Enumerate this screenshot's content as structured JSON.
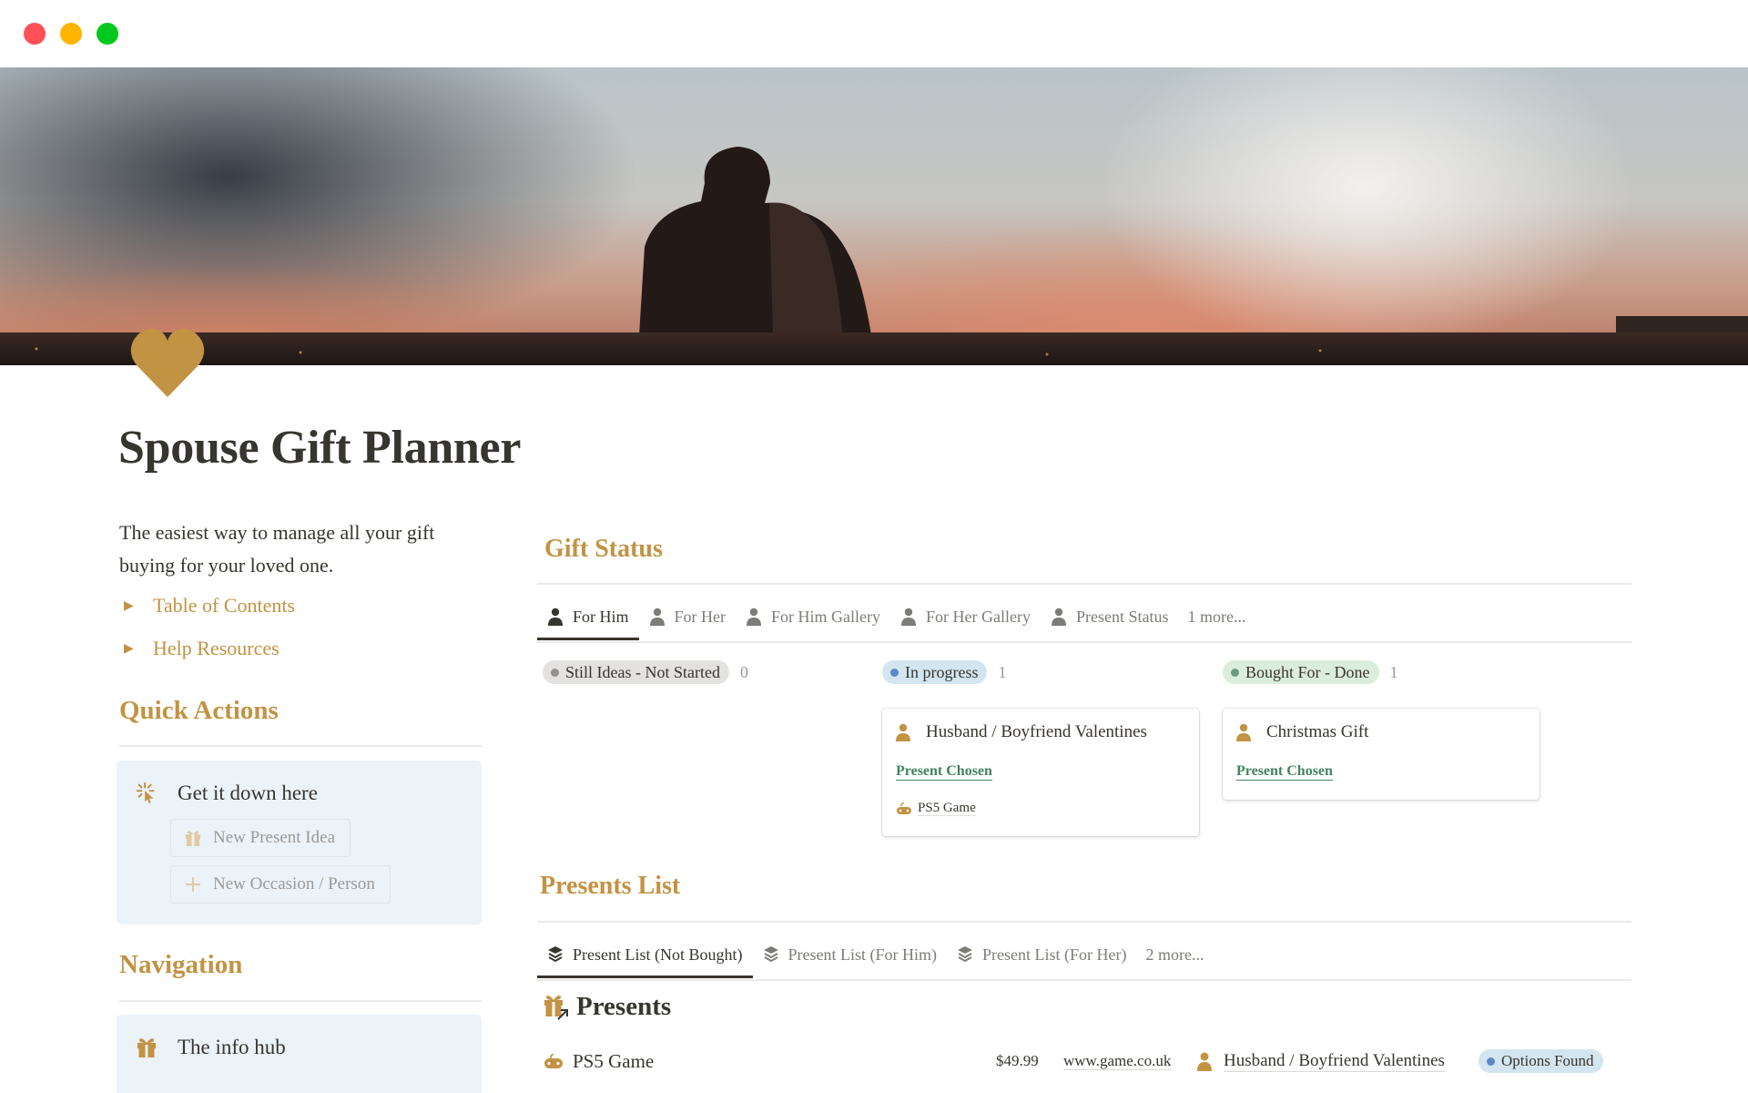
{
  "window": {
    "controls": [
      "close",
      "minimize",
      "maximize"
    ]
  },
  "cover": {
    "description": "Couple silhouette at sunset over city skyline"
  },
  "page": {
    "icon": "heart-icon",
    "icon_color": "#c29343",
    "title": "Spouse Gift Planner",
    "intro": "The easiest way to manage all your gift buying for your loved one."
  },
  "toggles": [
    {
      "label": "Table of Contents",
      "icon": "triangle-right-icon"
    },
    {
      "label": "Help Resources",
      "icon": "triangle-right-icon"
    }
  ],
  "quick_actions": {
    "heading": "Quick Actions",
    "callout_title": "Get it down here",
    "callout_icon": "cursor-click-icon",
    "buttons": [
      {
        "label": "New Present Idea",
        "icon": "gift-icon"
      },
      {
        "label": "New Occasion / Person",
        "icon": "plus-icon"
      }
    ]
  },
  "navigation": {
    "heading": "Navigation",
    "items": [
      {
        "label": "The info hub",
        "icon": "gift-icon"
      }
    ]
  },
  "gift_status": {
    "heading": "Gift Status",
    "tabs": [
      {
        "label": "For Him",
        "icon": "person-icon",
        "active": true
      },
      {
        "label": "For Her",
        "icon": "person-icon",
        "active": false
      },
      {
        "label": "For Him Gallery",
        "icon": "person-icon",
        "active": false
      },
      {
        "label": "For Her Gallery",
        "icon": "person-icon",
        "active": false
      },
      {
        "label": "Present Status",
        "icon": "person-icon",
        "active": false
      }
    ],
    "more_label": "1 more...",
    "groups": [
      {
        "label": "Still Ideas - Not Started",
        "count": "0",
        "bg": "#e3e2e0",
        "dot": "#91918e"
      },
      {
        "label": "In progress",
        "count": "1",
        "bg": "#d3e5ef",
        "dot": "#5e87c9"
      },
      {
        "label": "Bought For - Done",
        "count": "1",
        "bg": "#dbeddb",
        "dot": "#6c9b7d"
      }
    ],
    "cards": [
      {
        "title": "Husband / Boyfriend Valentines",
        "status": "Present Chosen",
        "related": "PS5 Game",
        "related_icon": "gamepad-icon"
      },
      {
        "title": "Christmas Gift",
        "status": "Present Chosen"
      }
    ]
  },
  "presents_list": {
    "heading": "Presents List",
    "tabs": [
      {
        "label": "Present List (Not Bought)",
        "icon": "stack-icon",
        "active": true
      },
      {
        "label": "Present List (For Him)",
        "icon": "stack-icon",
        "active": false
      },
      {
        "label": "Present List (For Her)",
        "icon": "stack-icon",
        "active": false
      }
    ],
    "more_label": "2 more...",
    "db_title": "Presents",
    "db_icon": "gift-link-icon",
    "rows": [
      {
        "name": "PS5 Game",
        "icon": "gamepad-icon",
        "price": "$49.99",
        "url": "www.game.co.uk",
        "person": "Husband / Boyfriend Valentines",
        "status": "Options Found",
        "status_dot": "#5e87c9"
      }
    ]
  },
  "colors": {
    "accent": "#c29343",
    "text": "#37352f",
    "muted": "#7d7c78",
    "callout_bg": "#ebf2f8",
    "green_link": "#448361"
  }
}
